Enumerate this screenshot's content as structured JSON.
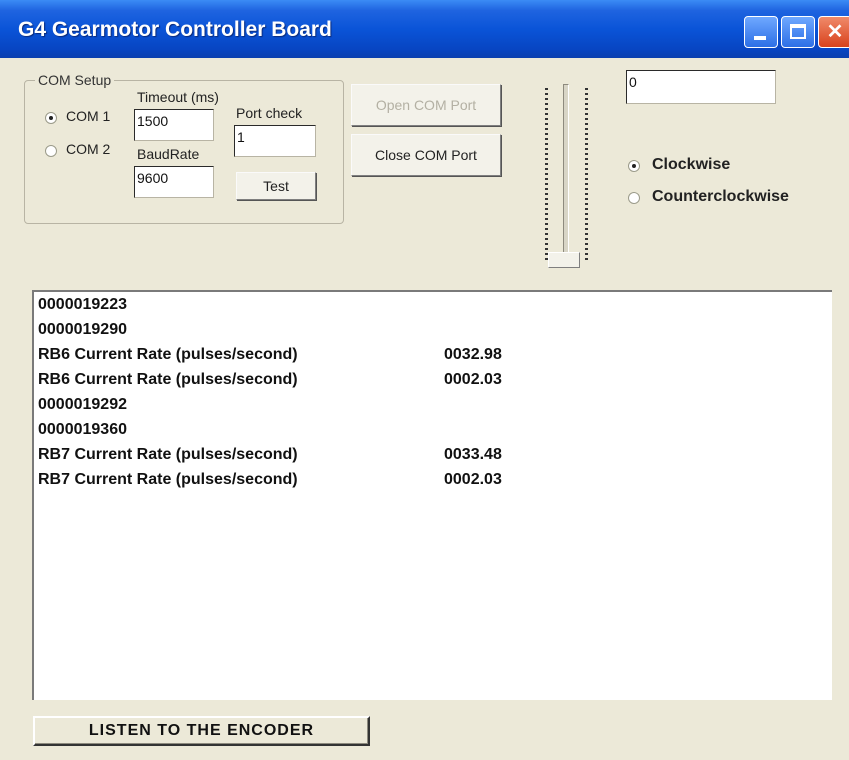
{
  "window": {
    "title": "G4 Gearmotor Controller Board"
  },
  "com_setup": {
    "legend": "COM Setup",
    "com1_label": "COM 1",
    "com2_label": "COM 2",
    "selected": "COM 1",
    "timeout_label": "Timeout (ms)",
    "timeout_value": "1500",
    "baudrate_label": "BaudRate",
    "baudrate_value": "9600",
    "port_check_label": "Port check",
    "port_check_value": "1",
    "test_label": "Test"
  },
  "buttons": {
    "open_com_port": "Open COM Port",
    "close_com_port": "Close COM Port",
    "listen": "LISTEN  TO  THE  ENCODER"
  },
  "speed": {
    "value_field": "0",
    "slider_level": 0
  },
  "direction": {
    "clockwise_label": "Clockwise",
    "counterclockwise_label": "Counterclockwise",
    "selected": "Clockwise"
  },
  "output": {
    "lines": [
      {
        "text": "0000019223",
        "value": ""
      },
      {
        "text": "0000019290",
        "value": ""
      },
      {
        "text": "RB6 Current Rate (pulses/second)",
        "value": "0032.98"
      },
      {
        "text": "RB6 Current Rate (pulses/second)",
        "value": "0002.03"
      },
      {
        "text": "0000019292",
        "value": ""
      },
      {
        "text": "0000019360",
        "value": ""
      },
      {
        "text": "RB7 Current Rate (pulses/second)",
        "value": "0033.48"
      },
      {
        "text": "RB7 Current Rate (pulses/second)",
        "value": "0002.03"
      }
    ]
  }
}
